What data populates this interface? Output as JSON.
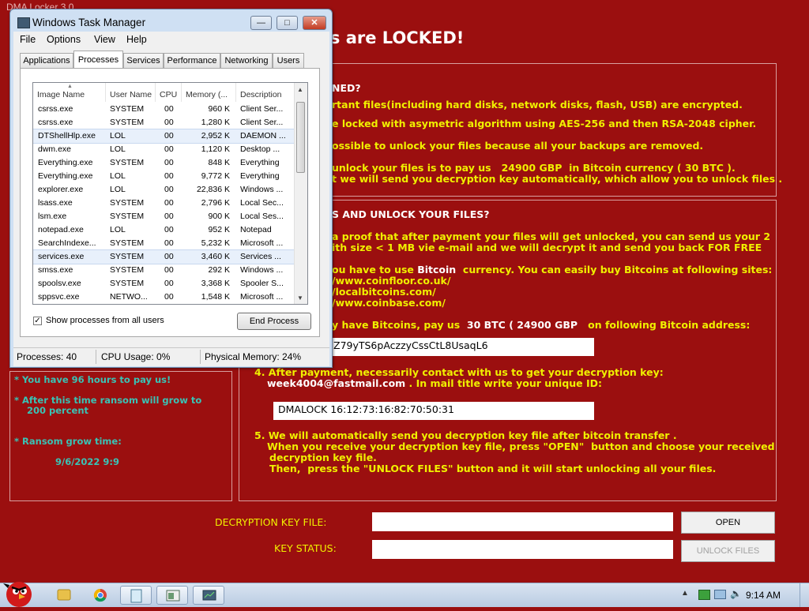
{
  "background_app": {
    "title": "DMA Locker 3.0",
    "headline": "rsonal files are LOCKED!",
    "section1": {
      "heading": "NED?",
      "line1": "rtant files(including hard disks, network disks, flash, USB) are encrypted.",
      "line2": "e locked with asymetric algorithm using AES-256 and then RSA-2048 cipher.",
      "line3": "ossible to unlock your files because all your backups are removed.",
      "line4": "unlock your files is to pay us   24900 GBP  in Bitcoin currency ( 30 BTC ).",
      "line5": "t we will send you decryption key automatically, which allow you to unlock files ."
    },
    "section2": {
      "heading": "S AND UNLOCK YOUR FILES?",
      "line1": "a proof that after payment your files will get unlocked, you can send us your 2",
      "line2": "ith size < 1 MB vie e-mail and we will decrypt it and send you back FOR FREE",
      "line3a": "ou have to use ",
      "line3b": "Bitcoin",
      "line3c": "  currency. You can easily buy Bitcoins at following sites:",
      "site1": "/www.coinfloor.co.uk/",
      "site2": "/localbitcoins.com/",
      "site3": "/www.coinbase.com/",
      "line4a": "y have Bitcoins, pay us ",
      "line4b": " 30 BTC ( 24900 GBP ",
      "line4c": "  on following Bitcoin address:",
      "btc_address": "Z79yTS6pAczzyCssCtL8UsaqL6",
      "step4_line1": "4. After payment, necessarily contact with us to get your decryption key:",
      "step4_email": "week4004@fastmail.com",
      "step4_rest": " . In mail title write your unique ID:",
      "unique_id": "DMALOCK 16:12:73:16:82:70:50:31",
      "step5_line1": "5. We will automatically send you decryption key file after bitcoin transfer .",
      "step5_line2": "When you receive your decryption key file, press \"OPEN\"  button and choose your received",
      "step5_line3": "decryption key file.",
      "step5_line4": "Then,  press the \"UNLOCK FILES\" button and it will start unlocking all your files."
    },
    "left_panel": {
      "line1": "* You have 96 hours to pay us!",
      "line2": "* After this time ransom will grow to",
      "line3": "200 percent",
      "line4": "* Ransom grow time:",
      "line5": "9/6/2022 9:9"
    },
    "bottom": {
      "decryption_key_label": "DECRYPTION KEY FILE:",
      "key_status_label": "KEY STATUS:",
      "open_button": "OPEN",
      "unlock_button": "UNLOCK FILES"
    }
  },
  "task_manager": {
    "title": "Windows Task Manager",
    "menu": [
      "File",
      "Options",
      "View",
      "Help"
    ],
    "tabs": [
      "Applications",
      "Processes",
      "Services",
      "Performance",
      "Networking",
      "Users"
    ],
    "active_tab": "Processes",
    "columns": [
      "Image Name",
      "User Name",
      "CPU",
      "Memory (...",
      "Description"
    ],
    "rows": [
      {
        "image": "csrss.exe",
        "user": "SYSTEM",
        "cpu": "00",
        "mem": "960 K",
        "desc": "Client Ser..."
      },
      {
        "image": "csrss.exe",
        "user": "SYSTEM",
        "cpu": "00",
        "mem": "1,280 K",
        "desc": "Client Ser..."
      },
      {
        "image": "DTShellHlp.exe",
        "user": "LOL",
        "cpu": "00",
        "mem": "2,952 K",
        "desc": "DAEMON ..."
      },
      {
        "image": "dwm.exe",
        "user": "LOL",
        "cpu": "00",
        "mem": "1,120 K",
        "desc": "Desktop ..."
      },
      {
        "image": "Everything.exe",
        "user": "SYSTEM",
        "cpu": "00",
        "mem": "848 K",
        "desc": "Everything"
      },
      {
        "image": "Everything.exe",
        "user": "LOL",
        "cpu": "00",
        "mem": "9,772 K",
        "desc": "Everything"
      },
      {
        "image": "explorer.exe",
        "user": "LOL",
        "cpu": "00",
        "mem": "22,836 K",
        "desc": "Windows ..."
      },
      {
        "image": "lsass.exe",
        "user": "SYSTEM",
        "cpu": "00",
        "mem": "2,796 K",
        "desc": "Local Sec..."
      },
      {
        "image": "lsm.exe",
        "user": "SYSTEM",
        "cpu": "00",
        "mem": "900 K",
        "desc": "Local Ses..."
      },
      {
        "image": "notepad.exe",
        "user": "LOL",
        "cpu": "00",
        "mem": "952 K",
        "desc": "Notepad"
      },
      {
        "image": "SearchIndexe...",
        "user": "SYSTEM",
        "cpu": "00",
        "mem": "5,232 K",
        "desc": "Microsoft ..."
      },
      {
        "image": "services.exe",
        "user": "SYSTEM",
        "cpu": "00",
        "mem": "3,460 K",
        "desc": "Services ..."
      },
      {
        "image": "smss.exe",
        "user": "SYSTEM",
        "cpu": "00",
        "mem": "292 K",
        "desc": "Windows ..."
      },
      {
        "image": "spoolsv.exe",
        "user": "SYSTEM",
        "cpu": "00",
        "mem": "3,368 K",
        "desc": "Spooler S..."
      },
      {
        "image": "sppsvc.exe",
        "user": "NETWO...",
        "cpu": "00",
        "mem": "1,548 K",
        "desc": "Microsoft ..."
      }
    ],
    "show_all_label": "Show processes from all users",
    "show_all_checked": true,
    "end_process_label": "End Process",
    "status": {
      "processes": "Processes: 40",
      "cpu": "CPU Usage: 0%",
      "memory": "Physical Memory: 24%"
    }
  },
  "taskbar": {
    "time": "9:14 AM"
  }
}
